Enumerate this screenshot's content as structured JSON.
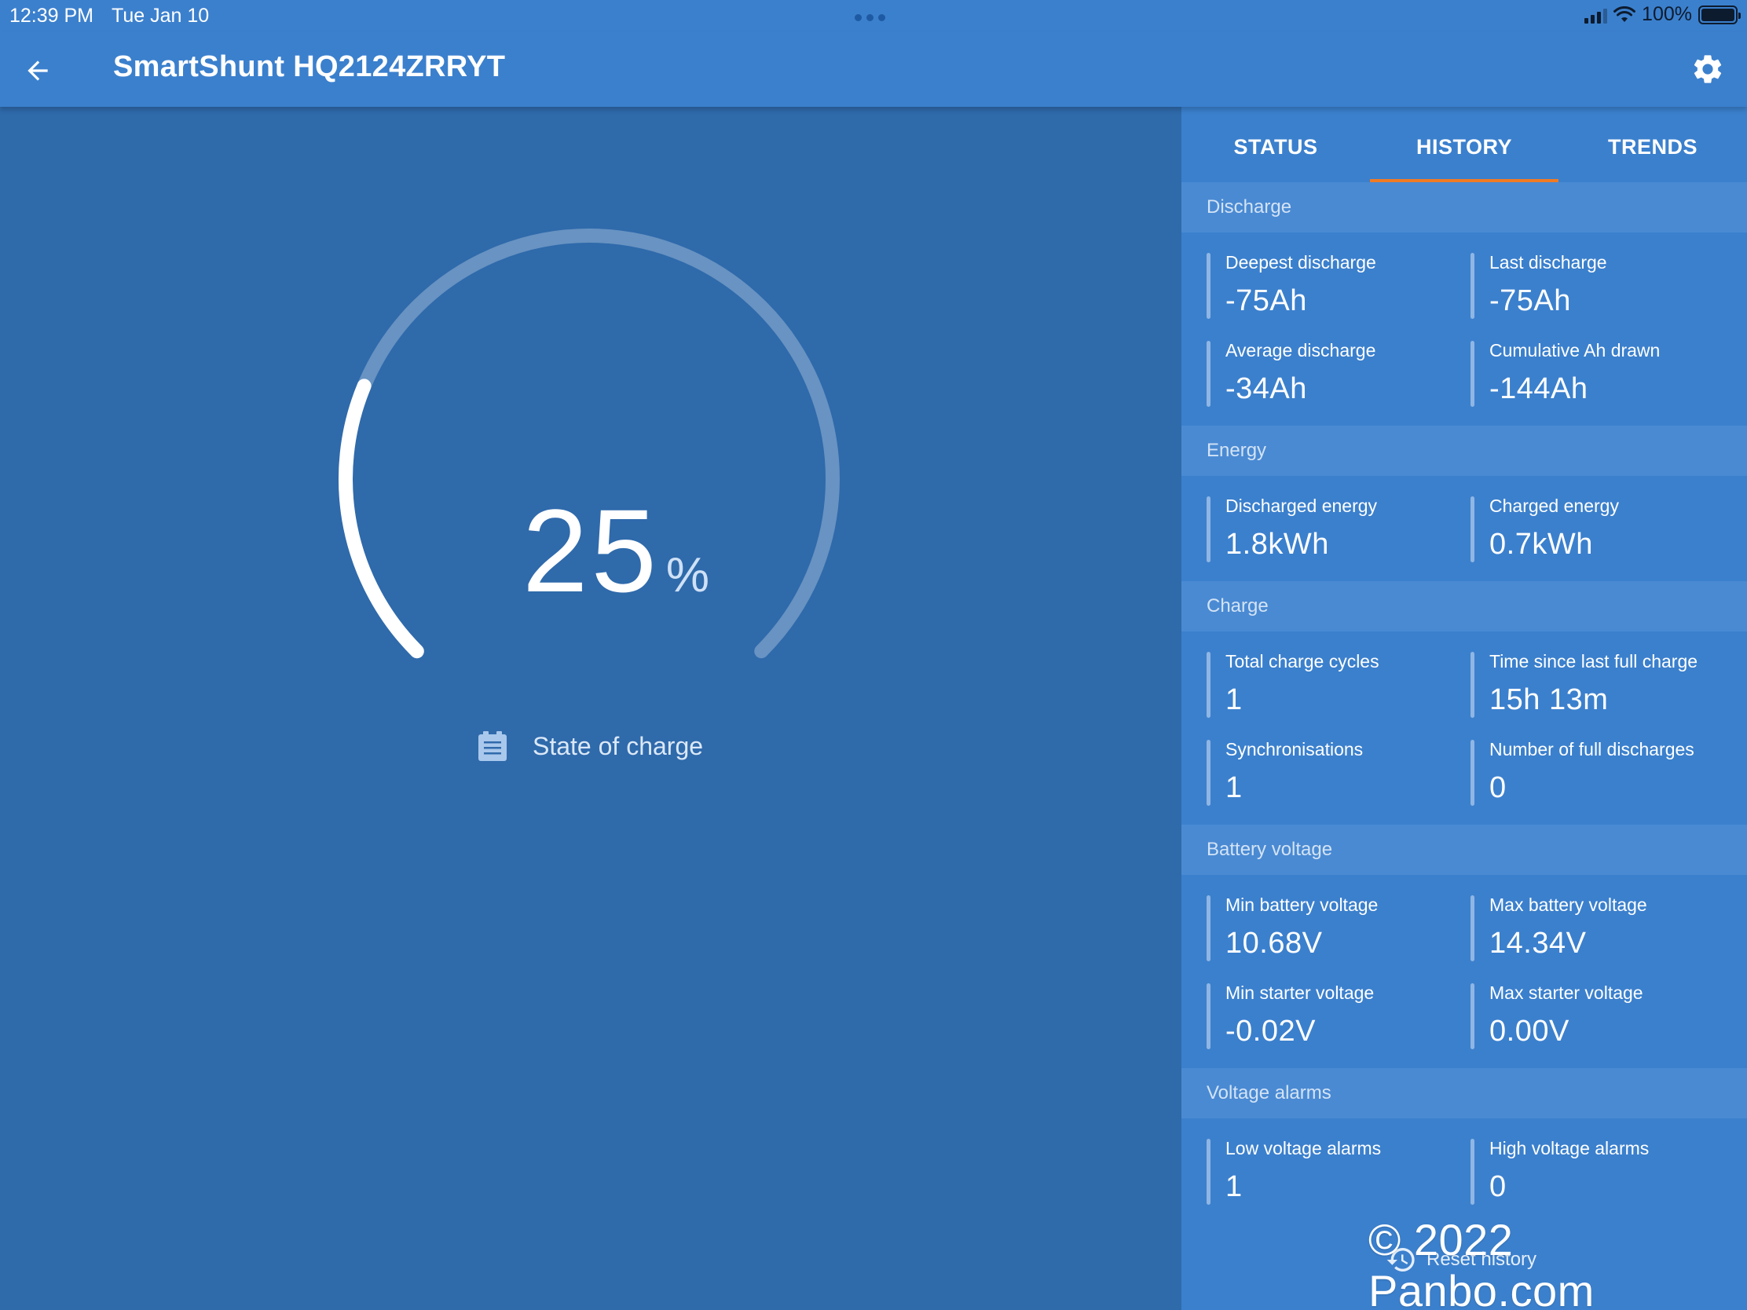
{
  "status_bar": {
    "time": "12:39 PM",
    "date": "Tue Jan 10",
    "battery_percent": "100%"
  },
  "app_bar": {
    "title": "SmartShunt HQ2124ZRRYT",
    "back_icon": "arrow-left-icon",
    "settings_icon": "gear-icon"
  },
  "gauge": {
    "value": "25",
    "unit": "%",
    "level_fraction": 0.25,
    "label": "State of charge",
    "label_icon": "battery-list-icon"
  },
  "tabs": [
    {
      "label": "STATUS",
      "active": false
    },
    {
      "label": "HISTORY",
      "active": true
    },
    {
      "label": "TRENDS",
      "active": false
    }
  ],
  "sections": [
    {
      "title": "Discharge",
      "items": [
        {
          "label": "Deepest discharge",
          "value": "-75Ah"
        },
        {
          "label": "Last discharge",
          "value": "-75Ah"
        },
        {
          "label": "Average discharge",
          "value": "-34Ah"
        },
        {
          "label": "Cumulative Ah drawn",
          "value": "-144Ah"
        }
      ]
    },
    {
      "title": "Energy",
      "items": [
        {
          "label": "Discharged energy",
          "value": "1.8kWh"
        },
        {
          "label": "Charged energy",
          "value": "0.7kWh"
        }
      ]
    },
    {
      "title": "Charge",
      "items": [
        {
          "label": "Total charge cycles",
          "value": "1"
        },
        {
          "label": "Time since last full charge",
          "value": "15h 13m"
        },
        {
          "label": "Synchronisations",
          "value": "1"
        },
        {
          "label": "Number of full discharges",
          "value": "0"
        }
      ]
    },
    {
      "title": "Battery voltage",
      "items": [
        {
          "label": "Min battery voltage",
          "value": "10.68V"
        },
        {
          "label": "Max battery voltage",
          "value": "14.34V"
        },
        {
          "label": "Min starter voltage",
          "value": "-0.02V"
        },
        {
          "label": "Max starter voltage",
          "value": "0.00V"
        }
      ]
    },
    {
      "title": "Voltage alarms",
      "items": [
        {
          "label": "Low voltage alarms",
          "value": "1"
        },
        {
          "label": "High voltage alarms",
          "value": "0"
        }
      ]
    }
  ],
  "reset": {
    "label": "Reset history",
    "icon": "history-icon"
  },
  "watermark": "© 2022 Panbo.com",
  "colors": {
    "app_bar": "#3b80cd",
    "left_background": "#2f6aab",
    "section_header": "#4a8ad3",
    "active_tab_indicator": "#f07b24"
  }
}
